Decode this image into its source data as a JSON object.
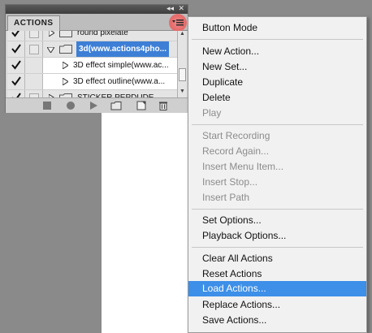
{
  "panel": {
    "collapse_glyph": "◂◂",
    "close_glyph": "✕",
    "tab_label": "ACTIONS",
    "flyout_icon": "panel-menu-icon",
    "rows": [
      {
        "label": "round pixelate",
        "type": "set",
        "expanded": false,
        "checked": true
      },
      {
        "label": "3d(www.actions4pho...",
        "type": "set",
        "expanded": true,
        "checked": true,
        "selected": true
      },
      {
        "label": "3D effect simple(www.ac...",
        "type": "action",
        "checked": true
      },
      {
        "label": "3D effect outline(www.a...",
        "type": "action",
        "checked": true
      },
      {
        "label": "STICKER PEPDUDE",
        "type": "set",
        "expanded": false,
        "checked": true
      }
    ],
    "bottom_buttons": [
      "stop-icon",
      "record-icon",
      "play-icon",
      "new-set-icon",
      "new-action-icon",
      "trash-icon"
    ]
  },
  "menu": {
    "items": [
      {
        "label": "Button Mode",
        "enabled": true
      },
      {
        "label": "New Action...",
        "enabled": true
      },
      {
        "label": "New Set...",
        "enabled": true
      },
      {
        "label": "Duplicate",
        "enabled": true
      },
      {
        "label": "Delete",
        "enabled": true
      },
      {
        "label": "Play",
        "enabled": false
      },
      {
        "label": "Start Recording",
        "enabled": false
      },
      {
        "label": "Record Again...",
        "enabled": false
      },
      {
        "label": "Insert Menu Item...",
        "enabled": false
      },
      {
        "label": "Insert Stop...",
        "enabled": false
      },
      {
        "label": "Insert Path",
        "enabled": false
      },
      {
        "label": "Set Options...",
        "enabled": true
      },
      {
        "label": "Playback Options...",
        "enabled": true
      },
      {
        "label": "Clear All Actions",
        "enabled": true
      },
      {
        "label": "Reset Actions",
        "enabled": true
      },
      {
        "label": "Load Actions...",
        "enabled": true,
        "highlighted": true
      },
      {
        "label": "Replace Actions...",
        "enabled": true
      },
      {
        "label": "Save Actions...",
        "enabled": true
      }
    ]
  },
  "colors": {
    "highlight": "#3d8fe8",
    "selection": "#3d7fd6",
    "flyout_button_glow": "#e66a6a"
  }
}
